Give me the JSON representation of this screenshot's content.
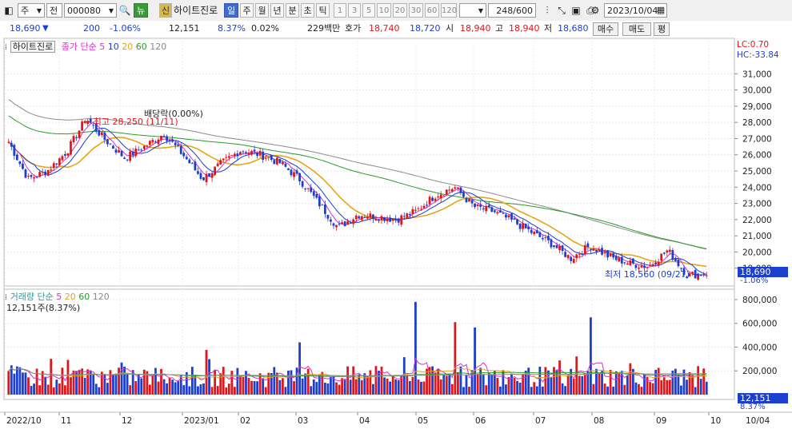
{
  "toolbar": {
    "market_label": "주",
    "exchange_label": "전",
    "stock_code": "000080",
    "news_label": "뉴",
    "credit_label": "신",
    "stock_name": "하이트진로",
    "periods": [
      "일",
      "주",
      "월",
      "년",
      "분",
      "초",
      "틱"
    ],
    "active_period": "일",
    "intervals": [
      "1",
      "3",
      "5",
      "10",
      "20",
      "30",
      "60",
      "120"
    ],
    "bar_count": "248/600",
    "date": "2023/10/04"
  },
  "quote": {
    "price": "18,690",
    "change_arrow": "▼",
    "change": "200",
    "change_pct": "-1.06%",
    "volume": "12,151",
    "volume_ratio": "8.37%",
    "turnover": "0.02%",
    "trade_value": "229백만",
    "bid_label": "호가",
    "ask": "18,740",
    "bid": "18,720",
    "open_label": "시",
    "open": "18,940",
    "high_label": "고",
    "high": "18,940",
    "low_label": "저",
    "low": "18,680",
    "buy_button": "매수",
    "sell_button": "매도",
    "eval_button": "평"
  },
  "price_legend": {
    "name_box": "하이트진로",
    "ma_label": "종가 단순",
    "ma5": "5",
    "ma10": "10",
    "ma20": "20",
    "ma60": "60",
    "ma120": "120",
    "lc": "LC:0.70",
    "hc": "HC:-33.84"
  },
  "volume_legend": {
    "label": "거래량 단순",
    "ma5": "5",
    "ma20": "20",
    "ma60": "60",
    "ma120": "120",
    "current": "12,151주(8.37%)"
  },
  "annotations": {
    "high": "최고 28,250 (11/11)",
    "low": "최저 18,560 (09/27)",
    "dividend": "배당락(0.00%)"
  },
  "price_tag": {
    "value": "18,690",
    "pct": "-1.06%"
  },
  "volume_tag": {
    "value": "12,151",
    "pct": "8.37%"
  },
  "colors": {
    "up": "#e0161b",
    "down": "#1d3fd0",
    "ma5": "#d633c8",
    "ma10": "#1a3cc8",
    "ma20": "#e8a317",
    "ma60": "#2a9a2a",
    "ma120": "#8a8a8a"
  },
  "chart_data": [
    {
      "type": "line",
      "title": "하이트진로 일봉",
      "y_ticks": [
        "31,000",
        "30,000",
        "29,000",
        "28,000",
        "27,000",
        "26,000",
        "25,000",
        "24,000",
        "23,000",
        "22,000",
        "21,000",
        "20,000",
        "19,000"
      ],
      "ylim": [
        18000,
        32200
      ],
      "x_ticks": [
        "2022/10",
        "11",
        "12",
        "2023/01",
        "02",
        "03",
        "04",
        "05",
        "06",
        "07",
        "08",
        "09",
        "10",
        "10/04"
      ],
      "close_series": [
        {
          "date": "2022/10",
          "close": 26800
        },
        {
          "date": "2022/10 mid",
          "close": 24500
        },
        {
          "date": "2022/10 end",
          "close": 25000
        },
        {
          "date": "11",
          "close": 26200
        },
        {
          "date": "11/11",
          "close": 28250
        },
        {
          "date": "11 end",
          "close": 26900
        },
        {
          "date": "12",
          "close": 25800
        },
        {
          "date": "12 mid",
          "close": 26500
        },
        {
          "date": "12 end",
          "close": 27300
        },
        {
          "date": "2023/01",
          "close": 26000
        },
        {
          "date": "01 mid",
          "close": 24500
        },
        {
          "date": "01 end",
          "close": 25500
        },
        {
          "date": "02",
          "close": 26300
        },
        {
          "date": "02 mid",
          "close": 26000
        },
        {
          "date": "02 end",
          "close": 25500
        },
        {
          "date": "03",
          "close": 24500
        },
        {
          "date": "03 mid",
          "close": 23000
        },
        {
          "date": "03 end",
          "close": 21500
        },
        {
          "date": "04",
          "close": 22300
        },
        {
          "date": "04 mid",
          "close": 22200
        },
        {
          "date": "04 end",
          "close": 22000
        },
        {
          "date": "05",
          "close": 22500
        },
        {
          "date": "05 mid",
          "close": 23500
        },
        {
          "date": "05 end",
          "close": 24000
        },
        {
          "date": "06",
          "close": 22800
        },
        {
          "date": "06 mid",
          "close": 22500
        },
        {
          "date": "06 end",
          "close": 21900
        },
        {
          "date": "07",
          "close": 21200
        },
        {
          "date": "07 mid",
          "close": 20500
        },
        {
          "date": "07 end",
          "close": 19600
        },
        {
          "date": "08",
          "close": 20400
        },
        {
          "date": "08 mid",
          "close": 19700
        },
        {
          "date": "08 end",
          "close": 19300
        },
        {
          "date": "09",
          "close": 19100
        },
        {
          "date": "09 mid",
          "close": 20100
        },
        {
          "date": "09/27",
          "close": 18560
        },
        {
          "date": "10/04",
          "close": 18690
        }
      ]
    },
    {
      "type": "bar",
      "title": "거래량",
      "y_ticks": [
        "800,000",
        "600,000",
        "400,000",
        "200,000"
      ],
      "ylim": [
        0,
        860000
      ],
      "highlights": [
        {
          "date": "05",
          "volume": 780000
        },
        {
          "date": "08",
          "volume": 650000
        },
        {
          "date": "05 end",
          "volume": 610000
        },
        {
          "date": "06",
          "volume": 565000
        },
        {
          "date": "03",
          "volume": 440000
        }
      ]
    }
  ]
}
